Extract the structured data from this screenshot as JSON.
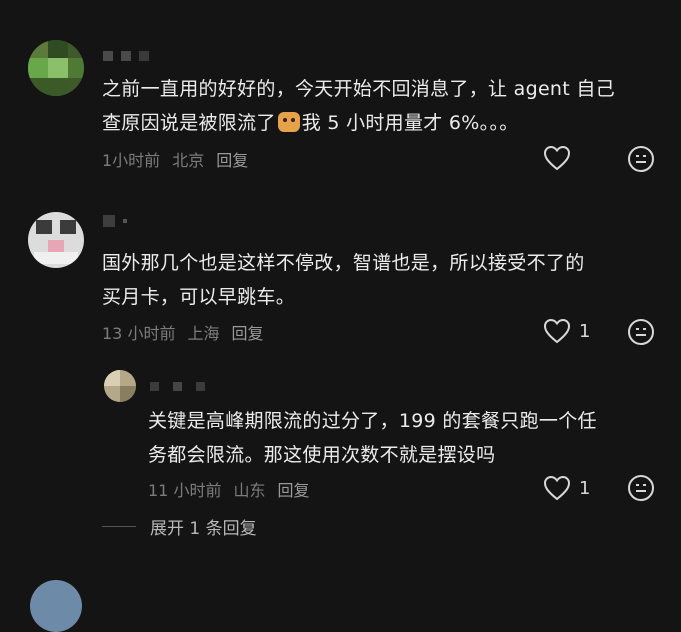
{
  "comments": [
    {
      "text_line1": "之前一直用的好好的，今天开始不回消息了，让 agent 自己",
      "text_line2_a": "查原因说是被限流了",
      "text_line2_b": "我 5 小时用量才 6%。。。",
      "time": "1小时前",
      "location": "北京",
      "reply": "回复"
    },
    {
      "text_line1": "国外那几个也是这样不停改，智谱也是，所以接受不了的",
      "text_line2": "买月卡，可以早跳车。",
      "time": "13 小时前",
      "location": "上海",
      "reply": "回复",
      "likes": "1"
    },
    {
      "text_line1": "关键是高峰期限流的过分了，199 的套餐只跑一个任",
      "text_line2": "务都会限流。那这使用次数不就是摆设吗",
      "time": "11 小时前",
      "location": "山东",
      "reply": "回复",
      "likes": "1"
    }
  ],
  "expand_label": "展开 1 条回复",
  "icons": {
    "like": "heart-outline-icon",
    "emoji": "smiley-face-icon",
    "inline_emoji": "dog-face-emoji"
  }
}
